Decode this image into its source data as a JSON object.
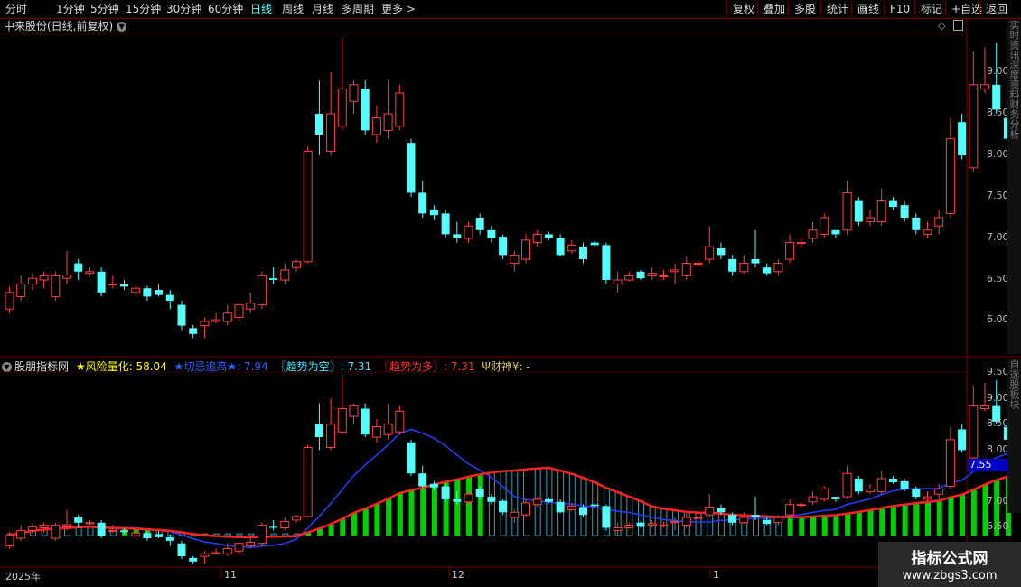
{
  "toolbar": {
    "timeframes": [
      "分时",
      "1分钟",
      "5分钟",
      "15分钟",
      "30分钟",
      "60分钟",
      "日线",
      "周线",
      "月线",
      "多周期",
      "更多"
    ],
    "active": "日线",
    "more_icon": "chevron-right-icon",
    "buttons": [
      "复权",
      "叠加",
      "多股",
      "统计",
      "画线",
      "F10",
      "标记",
      "+自选",
      "返回"
    ]
  },
  "main_panel": {
    "title": "中来股份(日线,前复权)",
    "y_ticks": [
      "9.00",
      "8.50",
      "8.00",
      "7.50",
      "7.00",
      "6.50",
      "6.00"
    ],
    "right_strip": "实时资讯深度资料财务分析"
  },
  "indicator_panel": {
    "title": "股朋指标网",
    "fields": [
      {
        "label": "★风险量化: ",
        "value": "58.04",
        "color": "#ffff00"
      },
      {
        "label": "★切忌追高★: ",
        "value": "7.94",
        "color": "#3060ff"
      },
      {
        "label": "〖趋势为空〗: ",
        "value": "7.31",
        "color": "#40e0ff"
      },
      {
        "label": "〖趋势为多〗: ",
        "value": "7.31",
        "color": "#ff3030"
      },
      {
        "label": "Ψ财神¥: ",
        "value": "-",
        "color": "#d0c060"
      }
    ],
    "y_ticks": [
      "9.50",
      "9.00",
      "8.50",
      "8.00",
      "7.50",
      "7.00",
      "6.50"
    ],
    "current_value": "7.55",
    "right_strip": "自选股板块"
  },
  "x_axis": [
    "2025年",
    "11",
    "12",
    "1"
  ],
  "watermark": {
    "line1": "指标公式网",
    "line2": "www.zbgs3.com"
  },
  "colors": {
    "up": "#ff4040",
    "down": "#54fcfc",
    "bg": "#000000",
    "grid": "#7a0000"
  },
  "chart_data": {
    "type": "candlestick",
    "price_scale": [
      5.7,
      9.55
    ],
    "candles": [
      [
        6.15,
        6.35,
        6.42,
        6.1
      ],
      [
        6.3,
        6.45,
        6.55,
        6.25
      ],
      [
        6.45,
        6.52,
        6.58,
        6.38
      ],
      [
        6.5,
        6.55,
        6.6,
        6.4
      ],
      [
        6.3,
        6.55,
        6.6,
        6.25
      ],
      [
        6.52,
        6.56,
        6.85,
        6.45
      ],
      [
        6.7,
        6.6,
        6.75,
        6.5
      ],
      [
        6.58,
        6.6,
        6.65,
        6.55
      ],
      [
        6.6,
        6.35,
        6.65,
        6.3
      ],
      [
        6.45,
        6.45,
        6.55,
        6.4
      ],
      [
        6.45,
        6.42,
        6.5,
        6.38
      ],
      [
        6.35,
        6.4,
        6.43,
        6.3
      ],
      [
        6.4,
        6.3,
        6.43,
        6.25
      ],
      [
        6.38,
        6.32,
        6.45,
        6.3
      ],
      [
        6.32,
        6.25,
        6.38,
        6.15
      ],
      [
        6.2,
        5.95,
        6.25,
        5.9
      ],
      [
        5.92,
        5.85,
        5.96,
        5.8
      ],
      [
        5.95,
        6.0,
        6.05,
        5.8
      ],
      [
        6.0,
        6.02,
        6.1,
        5.98
      ],
      [
        6.0,
        6.1,
        6.2,
        5.95
      ],
      [
        6.05,
        6.2,
        6.22,
        6.0
      ],
      [
        6.15,
        6.22,
        6.35,
        6.1
      ],
      [
        6.2,
        6.55,
        6.6,
        6.15
      ],
      [
        6.52,
        6.5,
        6.65,
        6.45
      ],
      [
        6.5,
        6.62,
        6.7,
        6.45
      ],
      [
        6.65,
        6.72,
        6.75,
        6.6
      ],
      [
        6.72,
        8.05,
        8.1,
        6.7
      ],
      [
        8.5,
        8.25,
        8.9,
        8.0
      ],
      [
        8.05,
        8.5,
        9.0,
        8.0
      ],
      [
        8.35,
        8.8,
        9.42,
        8.3
      ],
      [
        8.65,
        8.85,
        8.9,
        8.5
      ],
      [
        8.8,
        8.3,
        8.9,
        8.25
      ],
      [
        8.25,
        8.45,
        8.6,
        8.15
      ],
      [
        8.3,
        8.5,
        8.9,
        8.2
      ],
      [
        8.35,
        8.75,
        8.85,
        8.3
      ],
      [
        8.15,
        7.55,
        8.2,
        7.5
      ],
      [
        7.55,
        7.3,
        7.7,
        7.25
      ],
      [
        7.35,
        7.28,
        7.4,
        7.22
      ],
      [
        7.3,
        7.05,
        7.35,
        7.0
      ],
      [
        7.05,
        7.0,
        7.2,
        6.95
      ],
      [
        7.0,
        7.15,
        7.2,
        6.95
      ],
      [
        7.25,
        7.1,
        7.3,
        7.05
      ],
      [
        7.1,
        7.0,
        7.15,
        6.95
      ],
      [
        7.02,
        6.8,
        7.05,
        6.75
      ],
      [
        6.7,
        6.8,
        6.85,
        6.6
      ],
      [
        6.75,
        6.98,
        7.05,
        6.7
      ],
      [
        6.95,
        7.05,
        7.1,
        6.9
      ],
      [
        7.05,
        7.0,
        7.08,
        6.98
      ],
      [
        7.0,
        6.8,
        7.05,
        6.78
      ],
      [
        6.85,
        6.92,
        6.98,
        6.82
      ],
      [
        6.9,
        6.75,
        6.95,
        6.7
      ],
      [
        6.95,
        6.92,
        6.98,
        6.9
      ],
      [
        6.92,
        6.5,
        6.95,
        6.45
      ],
      [
        6.45,
        6.5,
        6.6,
        6.35
      ],
      [
        6.5,
        6.55,
        6.6,
        6.48
      ],
      [
        6.6,
        6.52,
        6.62,
        6.5
      ],
      [
        6.55,
        6.58,
        6.65,
        6.5
      ],
      [
        6.55,
        6.55,
        6.62,
        6.5
      ],
      [
        6.6,
        6.62,
        6.7,
        6.45
      ],
      [
        6.55,
        6.7,
        6.78,
        6.5
      ],
      [
        6.7,
        6.7,
        6.74,
        6.66
      ],
      [
        6.75,
        6.9,
        7.15,
        6.7
      ],
      [
        6.88,
        6.8,
        6.95,
        6.75
      ],
      [
        6.75,
        6.6,
        6.8,
        6.55
      ],
      [
        6.6,
        6.7,
        6.8,
        6.58
      ],
      [
        6.75,
        6.7,
        7.1,
        6.65
      ],
      [
        6.65,
        6.58,
        6.7,
        6.55
      ],
      [
        6.6,
        6.7,
        6.75,
        6.55
      ],
      [
        6.75,
        6.95,
        7.05,
        6.7
      ],
      [
        6.95,
        6.95,
        7.0,
        6.9
      ],
      [
        7.0,
        7.1,
        7.2,
        6.95
      ],
      [
        7.05,
        7.25,
        7.3,
        7.0
      ],
      [
        7.1,
        7.05,
        7.1,
        7.0
      ],
      [
        7.1,
        7.55,
        7.7,
        7.05
      ],
      [
        7.45,
        7.2,
        7.5,
        7.15
      ],
      [
        7.2,
        7.25,
        7.35,
        7.15
      ],
      [
        7.2,
        7.45,
        7.6,
        7.15
      ],
      [
        7.45,
        7.38,
        7.5,
        7.35
      ],
      [
        7.4,
        7.25,
        7.45,
        7.2
      ],
      [
        7.25,
        7.1,
        7.3,
        7.05
      ],
      [
        7.05,
        7.1,
        7.2,
        7.0
      ],
      [
        7.15,
        7.25,
        7.35,
        7.05
      ],
      [
        7.3,
        8.2,
        8.45,
        7.25
      ],
      [
        8.4,
        8.0,
        8.5,
        7.95
      ],
      [
        7.85,
        8.85,
        9.25,
        7.8
      ],
      [
        8.8,
        8.85,
        9.3,
        8.75
      ],
      [
        8.85,
        8.55,
        9.35,
        8.5
      ],
      [
        8.45,
        8.2,
        8.6,
        7.9
      ]
    ]
  }
}
